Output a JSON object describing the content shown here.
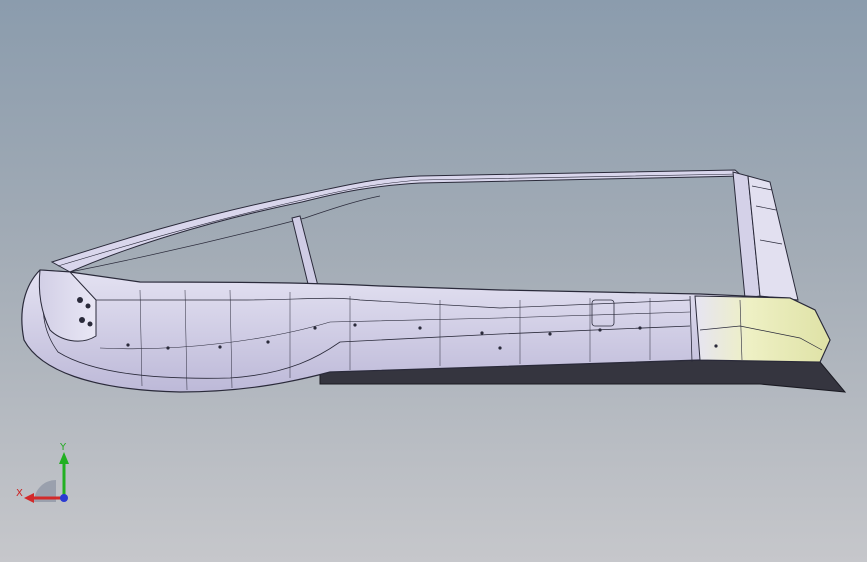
{
  "viewport": {
    "background_top": "#8b9cad",
    "background_bottom": "#c6c7cb"
  },
  "model": {
    "part_color": "#d8d6ec",
    "edge_color": "#2a2a3a",
    "highlight_color": "#ecefc0",
    "underside_color": "#3a3a44"
  },
  "triad": {
    "x_label": "X",
    "y_label": "Y",
    "x_color": "#d22a2a",
    "y_color": "#22b022",
    "z_color": "#2a3ad2"
  }
}
